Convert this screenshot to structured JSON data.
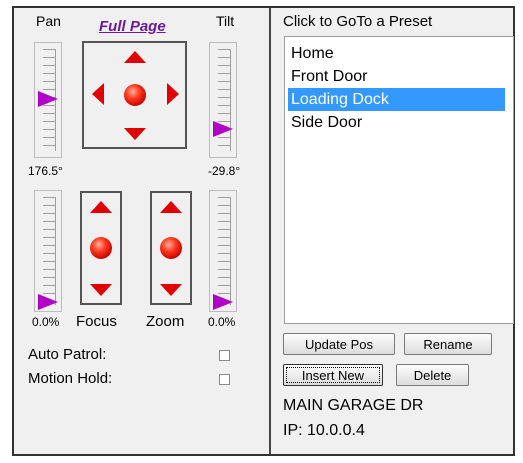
{
  "left": {
    "pan_label": "Pan",
    "full_page_link": "Full Page",
    "tilt_label": "Tilt",
    "pan_value": "176.5°",
    "tilt_value": "-29.8°",
    "focus_level_value": "0.0%",
    "focus_label": "Focus",
    "zoom_label": "Zoom",
    "zoom_level_value": "0.0%",
    "auto_patrol_label": "Auto Patrol:",
    "motion_hold_label": "Motion Hold:",
    "auto_patrol_checked": false,
    "motion_hold_checked": false
  },
  "presets": {
    "title": "Click to GoTo a Preset",
    "items": [
      "Home",
      "Front Door",
      "Loading Dock",
      "Side Door"
    ],
    "selected": "Loading Dock"
  },
  "buttons": {
    "update_pos": "Update Pos",
    "rename": "Rename",
    "insert_new": "Insert New",
    "delete": "Delete"
  },
  "camera": {
    "name": "MAIN GARAGE DR",
    "ip": "IP: 10.0.0.4"
  },
  "colors": {
    "accent_red": "#e00000",
    "thumb_purple": "#b000c8",
    "selection_blue": "#3399ff",
    "link_purple": "#6a1b9a"
  }
}
